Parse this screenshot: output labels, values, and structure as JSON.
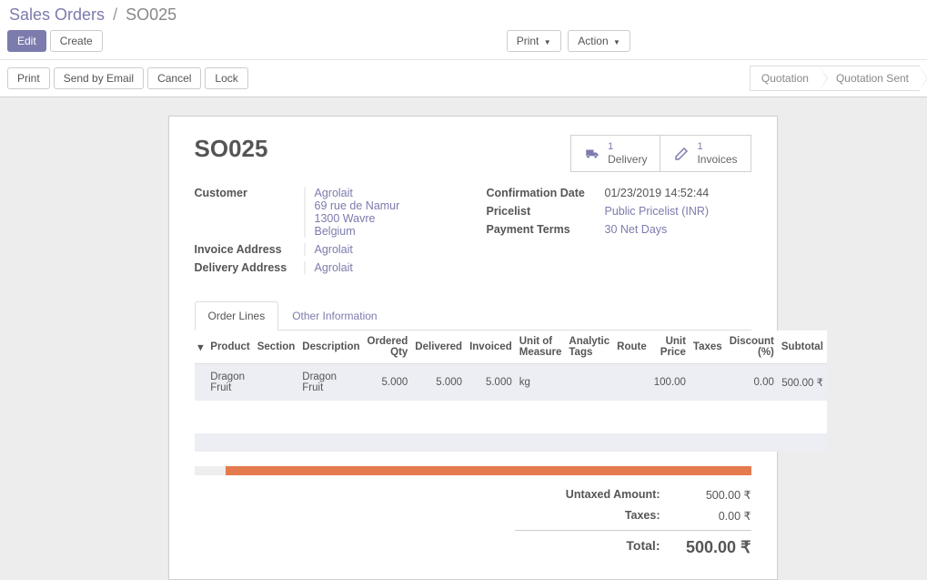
{
  "breadcrumb": {
    "parent": "Sales Orders",
    "current": "SO025"
  },
  "buttons": {
    "edit": "Edit",
    "create": "Create",
    "print_menu": "Print",
    "action_menu": "Action",
    "print": "Print",
    "send_email": "Send by Email",
    "cancel": "Cancel",
    "lock": "Lock"
  },
  "status": {
    "steps": [
      "Quotation",
      "Quotation Sent"
    ]
  },
  "order": {
    "name": "SO025",
    "customer": {
      "name": "Agrolait",
      "addr1": "69 rue de Namur",
      "addr2": "1300 Wavre",
      "addr3": "Belgium"
    },
    "invoice_address": "Agrolait",
    "delivery_address": "Agrolait",
    "confirmation_date": "01/23/2019 14:52:44",
    "pricelist": "Public Pricelist (INR)",
    "payment_terms": "30 Net Days"
  },
  "labels": {
    "customer": "Customer",
    "invoice_address": "Invoice Address",
    "delivery_address": "Delivery Address",
    "confirmation_date": "Confirmation Date",
    "pricelist": "Pricelist",
    "payment_terms": "Payment Terms"
  },
  "stats": {
    "delivery": {
      "count": "1",
      "label": "Delivery"
    },
    "invoices": {
      "count": "1",
      "label": "Invoices"
    }
  },
  "tabs": {
    "order_lines": "Order Lines",
    "other_info": "Other Information"
  },
  "columns": {
    "product": "Product",
    "section": "Section",
    "description": "Description",
    "ordered_qty": "Ordered Qty",
    "delivered": "Delivered",
    "invoiced": "Invoiced",
    "uom": "Unit of Measure",
    "analytic_tags": "Analytic Tags",
    "route": "Route",
    "unit_price": "Unit Price",
    "taxes": "Taxes",
    "discount": "Discount (%)",
    "subtotal": "Subtotal"
  },
  "lines": [
    {
      "product": "Dragon Fruit",
      "section": "",
      "description": "Dragon Fruit",
      "ordered_qty": "5.000",
      "delivered": "5.000",
      "invoiced": "5.000",
      "uom": "kg",
      "analytic_tags": "",
      "route": "",
      "unit_price": "100.00",
      "taxes": "",
      "discount": "0.00",
      "subtotal": "500.00 ₹"
    }
  ],
  "totals": {
    "untaxed_label": "Untaxed Amount:",
    "untaxed": "500.00 ₹",
    "taxes_label": "Taxes:",
    "taxes": "0.00 ₹",
    "total_label": "Total:",
    "total": "500.00 ₹"
  }
}
